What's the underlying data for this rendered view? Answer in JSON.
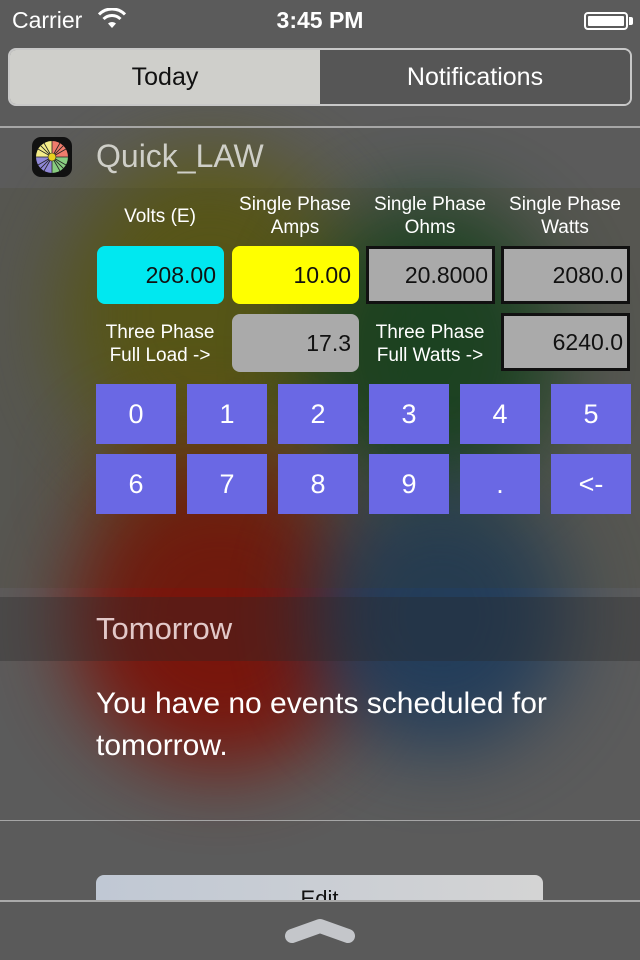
{
  "status_bar": {
    "carrier": "Carrier",
    "time": "3:45 PM",
    "wifi_icon": "wifi-icon",
    "battery_icon": "battery-full-icon"
  },
  "segmented": {
    "tabs": [
      {
        "label": "Today",
        "selected": true
      },
      {
        "label": "Notifications",
        "selected": false
      }
    ]
  },
  "widget": {
    "app_name": "Quick_LAW",
    "app_icon": "color-wheel-icon",
    "columns": [
      {
        "label": "Volts (E)",
        "value": "208.00",
        "color": "#00e8f0"
      },
      {
        "label": "Single Phase\nAmps",
        "value": "10.00",
        "color": "#ffff00"
      },
      {
        "label": "Single Phase\nOhms",
        "value": "20.8000",
        "color": "#aaaaaa"
      },
      {
        "label": "Single Phase\nWatts",
        "value": "2080.0",
        "color": "#aaaaaa"
      }
    ],
    "three_phase": {
      "full_load_label": "Three Phase\nFull Load ->",
      "full_load_value": "17.3",
      "full_watts_label": "Three Phase\nFull Watts ->",
      "full_watts_value": "6240.0"
    },
    "keypad": [
      "0",
      "1",
      "2",
      "3",
      "4",
      "5",
      "6",
      "7",
      "8",
      "9",
      ".",
      "<-"
    ],
    "keypad_color": "#6a68e4"
  },
  "tomorrow": {
    "title": "Tomorrow",
    "message": "You have no events scheduled for tomorrow."
  },
  "edit_button": {
    "label": "Edit"
  },
  "grabber_icon": "chevron-up-icon"
}
